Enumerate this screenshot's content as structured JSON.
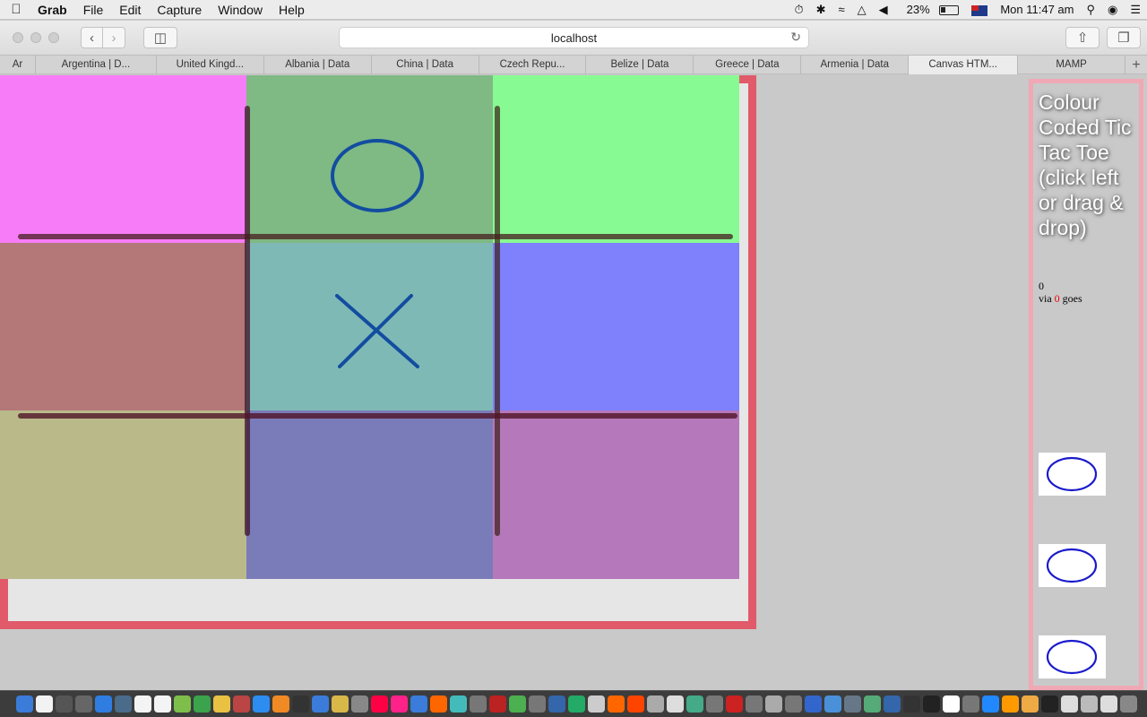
{
  "menubar": {
    "app_name": "Grab",
    "items": [
      "File",
      "Edit",
      "Capture",
      "Window",
      "Help"
    ],
    "battery": "23%",
    "clock": "Mon 11:47 am"
  },
  "toolbar": {
    "address": "localhost",
    "back_icon": "‹",
    "forward_icon": "›"
  },
  "tabs": [
    {
      "label": "Ar",
      "width": 40
    },
    {
      "label": "Argentina | D...",
      "width": 135
    },
    {
      "label": "United Kingd...",
      "width": 120
    },
    {
      "label": "Albania | Data",
      "width": 120
    },
    {
      "label": "China | Data",
      "width": 120
    },
    {
      "label": "Czech Repu...",
      "width": 120
    },
    {
      "label": "Belize | Data",
      "width": 120
    },
    {
      "label": "Greece | Data",
      "width": 120
    },
    {
      "label": "Armenia | Data",
      "width": 120
    },
    {
      "label": "Canvas HTM...",
      "width": 122
    },
    {
      "label": "MAMP",
      "width": 120
    }
  ],
  "game": {
    "cell_colors": [
      "#f77cf7",
      "#7fb984",
      "#88fa93",
      "#b47878",
      "#7fb9b6",
      "#7e80fc",
      "#b9b98a",
      "#7a7bb9",
      "#b578bb"
    ],
    "marks": {
      "1": "O",
      "4": "X"
    },
    "mark_color": "#124da0"
  },
  "panel": {
    "title": "Colour Coded Tic Tac Toe (click left or drag & drop)",
    "score": "0",
    "via_label": "via",
    "goes_count": "0",
    "goes_label": "goes",
    "piece_color": "#1a1acc"
  },
  "dock": {
    "icons": [
      "#3b7bd9",
      "#f2f2f2",
      "#555",
      "#666",
      "#2f7de1",
      "#4a6b8a",
      "#f4f4f4",
      "#f4f4f4",
      "#7dbf4a",
      "#3aa34b",
      "#e9c244",
      "#b44",
      "#2d8cf0",
      "#f08a24",
      "#333",
      "#3b7bd9",
      "#d9b84a",
      "#888",
      "#f04",
      "#f28",
      "#3b7bd9",
      "#f60",
      "#4bb",
      "#777",
      "#b22",
      "#4caf50",
      "#777",
      "#36a",
      "#2a6",
      "#ccc",
      "#f60",
      "#f40",
      "#aaa",
      "#ddd",
      "#4a8",
      "#777",
      "#c22",
      "#777",
      "#aaa",
      "#777",
      "#36c",
      "#4a90d9",
      "#678",
      "#5a7",
      "#36a",
      "#333",
      "#222",
      "#fff",
      "#777",
      "#28f",
      "#f90",
      "#ea4",
      "#222",
      "#ddd",
      "#bbb",
      "#ddd",
      "#888"
    ]
  }
}
